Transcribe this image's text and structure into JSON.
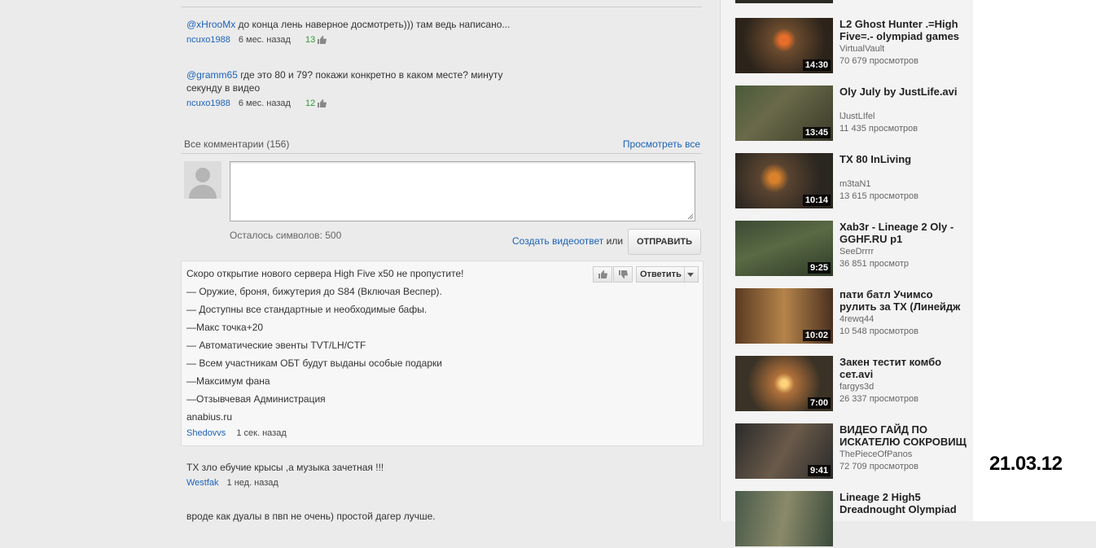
{
  "top_comments": [
    {
      "mention": "@xHrooMx",
      "text": " до конца лень наверное досмотреть))) там ведь написано...",
      "author": "ncuxo1988",
      "time": "6 мес. назад",
      "likes": "13"
    },
    {
      "mention": "@gramm65",
      "text": " где это 80 и 79? покажи конкретно в каком месте? минуту секунду в видео",
      "author": "ncuxo1988",
      "time": "6 мес. назад",
      "likes": "12"
    }
  ],
  "all_comments": {
    "title": "Все комментарии (156)",
    "view_all": "Просмотреть все"
  },
  "composer": {
    "remaining": "Осталось символов: 500",
    "video_reply": "Создать видеоответ",
    "or": " или ",
    "send": "ОТПРАВИТЬ"
  },
  "highlight": {
    "lines": [
      "Скоро открытие нового сервера High Five x50 не пропустите!",
      "— Оружие, броня, бижутерия до S84 (Включая Веспер).",
      "— Доступны все стандартные и необходимые бафы.",
      "—Макс точка+20",
      "— Автоматические эвенты TVT/LH/CTF",
      "— Всем участникам ОБТ будут выданы особые подарки",
      "—Максимум фана",
      "—Отзывчевая Администрация",
      "anabius.ru"
    ],
    "author": "Shedovvs",
    "time": "1 сек. назад",
    "reply": "Ответить"
  },
  "later_comments": [
    {
      "text": "ТХ зло ебучие крысы ,а музыка зачетная !!!",
      "author": "Westfak",
      "time": "1 нед. назад"
    },
    {
      "text": "вроде как дуалы в пвп не очень) простой дагер лучше.",
      "author": "",
      "time": ""
    }
  ],
  "related": [
    {
      "title": "L2 Ghost Hunter .=High Five=.- olympiad games",
      "channel": "VirtualVault",
      "views": "70 679 просмотров",
      "duration": "14:30"
    },
    {
      "title": "Oly July by JustLife.avi",
      "channel": "lJustLIfel",
      "views": "11 435 просмотров",
      "duration": "13:45"
    },
    {
      "title": "TX 80 InLiving",
      "channel": "m3taN1",
      "views": "13 615 просмотров",
      "duration": "10:14"
    },
    {
      "title": "Xab3r - Lineage 2 Oly - GGHF.RU p1",
      "channel": "SeeDrrrr",
      "views": "36 851 просмотр",
      "duration": "9:25"
    },
    {
      "title": "пати батл Учимсо рулить за ТХ (Линейдж",
      "channel": "4rewq44",
      "views": "10 548 просмотров",
      "duration": "10:02"
    },
    {
      "title": "Закен тестит комбо сет.avi",
      "channel": "fargys3d",
      "views": "26 337 просмотров",
      "duration": "7:00"
    },
    {
      "title": "ВИДЕО ГАЙД ПО ИСКАТЕЛЮ СОКРОВИЩ",
      "channel": "ThePieceOfPanos",
      "views": "72 709 просмотров",
      "duration": "9:41"
    },
    {
      "title": "Lineage 2 High5 Dreadnought Olympiad",
      "channel": "",
      "views": "",
      "duration": ""
    }
  ],
  "date_stamp": "21.03.12"
}
